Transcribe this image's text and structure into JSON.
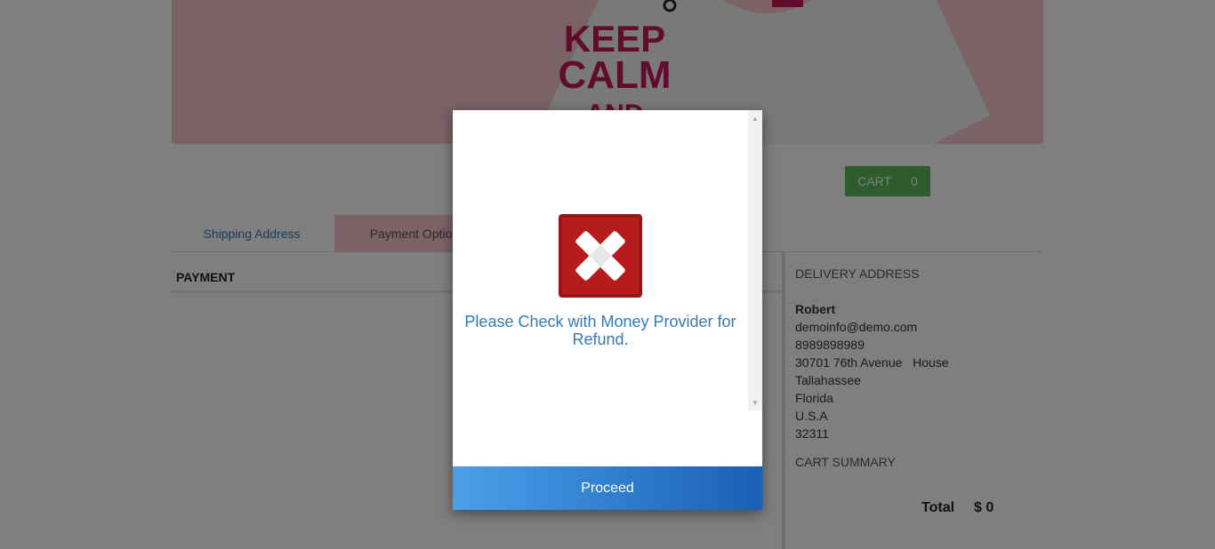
{
  "banner": {
    "shirt_line1": "KEEP",
    "shirt_line2": "CALM",
    "shirt_line3": "AND"
  },
  "cart": {
    "label": "CART",
    "count": "0"
  },
  "tabs": [
    {
      "label": "Shipping Address"
    },
    {
      "label": "Payment Option"
    }
  ],
  "payment": {
    "heading": "PAYMENT"
  },
  "delivery": {
    "title": "DELIVERY ADDRESS",
    "name": "Robert",
    "email": "demoinfo@demo.com",
    "phone": "8989898989",
    "street": "30701 76th Avenue   House",
    "city": "Tallahassee",
    "state": "Florida",
    "country": "U.S.A",
    "zip": "32311"
  },
  "cart_summary": {
    "title": "CART SUMMARY",
    "total_label": "Total",
    "total_value": "$ 0"
  },
  "modal": {
    "message": "Please Check with Money Provider for Refund.",
    "proceed_label": "Proceed"
  },
  "colors": {
    "banner_pink": "#f4c4cf",
    "cart_green": "#5cb85c",
    "error_red": "#b71c1c",
    "link_blue": "#337ab7"
  }
}
